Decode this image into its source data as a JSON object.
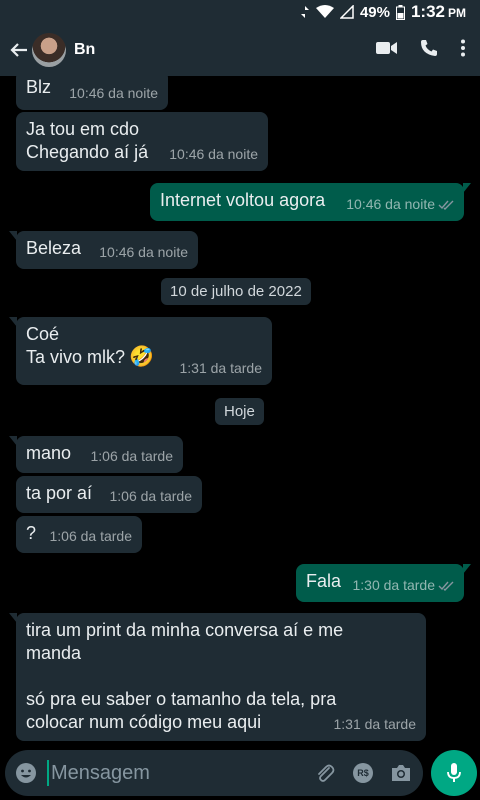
{
  "status": {
    "battery": "49%",
    "time": "1:32",
    "ampm": "PM"
  },
  "header": {
    "contact_name": "Bn"
  },
  "messages": [
    {
      "dir": "in",
      "lines": [
        "Blz"
      ],
      "time": "10:46 da noite"
    },
    {
      "dir": "in",
      "lines": [
        "Ja tou em cdo",
        "Chegando aí já"
      ],
      "time": "10:46 da noite"
    },
    {
      "dir": "out",
      "lines": [
        "Internet voltou agora"
      ],
      "time": "10:46 da noite"
    },
    {
      "dir": "in",
      "lines": [
        "Beleza"
      ],
      "time": "10:46 da noite"
    },
    {
      "dir": "date",
      "label": "10 de julho de 2022"
    },
    {
      "dir": "in",
      "lines": [
        "Coé",
        "Ta vivo mlk?"
      ],
      "emoji": "🤣",
      "time": "1:31 da tarde"
    },
    {
      "dir": "date",
      "label": "Hoje"
    },
    {
      "dir": "in",
      "lines": [
        "mano"
      ],
      "time": "1:06 da tarde"
    },
    {
      "dir": "in",
      "lines": [
        "ta por aí"
      ],
      "time": "1:06 da tarde"
    },
    {
      "dir": "in",
      "lines": [
        "?"
      ],
      "time": "1:06 da tarde"
    },
    {
      "dir": "out",
      "lines": [
        "Fala"
      ],
      "time": "1:30 da tarde"
    },
    {
      "dir": "in",
      "lines": [
        "tira um print da minha conversa aí e me",
        "manda",
        "",
        "só pra eu saber o tamanho da tela, pra",
        "colocar num código meu aqui"
      ],
      "time": "1:31 da tarde"
    }
  ],
  "input": {
    "placeholder": "Mensagem"
  },
  "icons": {
    "back": "arrow-left-icon",
    "video": "video-call-icon",
    "call": "phone-icon",
    "menu": "more-vert-icon",
    "emoji": "emoji-icon",
    "attach": "paperclip-icon",
    "payment": "rs-payment-icon",
    "camera": "camera-icon",
    "mic": "mic-icon"
  },
  "colors": {
    "incoming": "#1f2c34",
    "outgoing": "#005c4b",
    "accent": "#00a884",
    "background": "#000000"
  }
}
